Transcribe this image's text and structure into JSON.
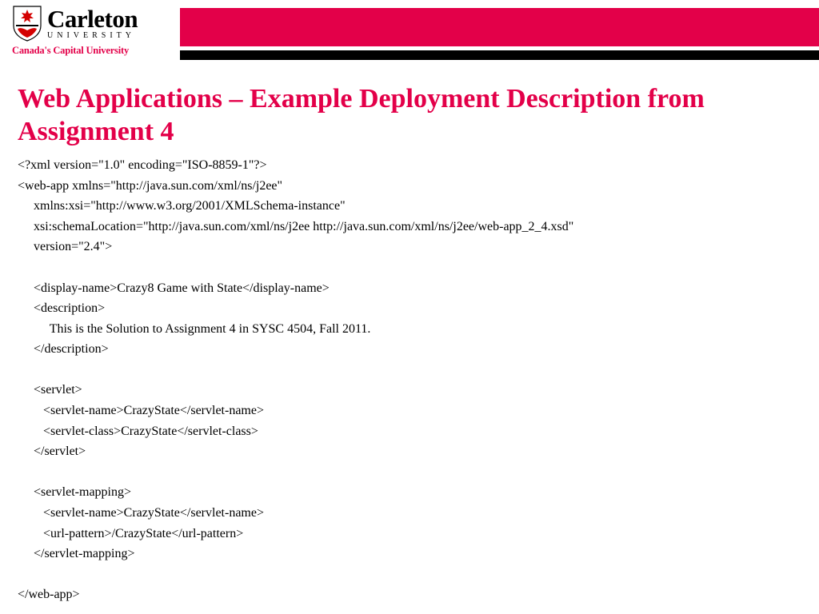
{
  "header": {
    "wordmark_main": "Carleton",
    "wordmark_sub": "UNIVERSITY",
    "tagline": "Canada's Capital University"
  },
  "page_title": "Web Applications – Example Deployment Description from Assignment 4",
  "code": {
    "l01": "<?xml version=\"1.0\" encoding=\"ISO-8859-1\"?>",
    "l02": "<web-app xmlns=\"http://java.sun.com/xml/ns/j2ee\"",
    "l03": "     xmlns:xsi=\"http://www.w3.org/2001/XMLSchema-instance\"",
    "l04": "     xsi:schemaLocation=\"http://java.sun.com/xml/ns/j2ee http://java.sun.com/xml/ns/j2ee/web-app_2_4.xsd\"",
    "l05": "     version=\"2.4\">",
    "l06": "",
    "l07": "     <display-name>Crazy8 Game with State</display-name>",
    "l08": "     <description>",
    "l09": "          This is the Solution to Assignment 4 in SYSC 4504, Fall 2011.",
    "l10": "     </description>",
    "l11": "",
    "l12": "     <servlet>",
    "l13": "        <servlet-name>CrazyState</servlet-name>",
    "l14": "        <servlet-class>CrazyState</servlet-class>",
    "l15": "     </servlet>",
    "l16": "",
    "l17": "     <servlet-mapping>",
    "l18": "        <servlet-name>CrazyState</servlet-name>",
    "l19": "        <url-pattern>/CrazyState</url-pattern>",
    "l20": "     </servlet-mapping>",
    "l21": "",
    "l22": "</web-app>"
  }
}
